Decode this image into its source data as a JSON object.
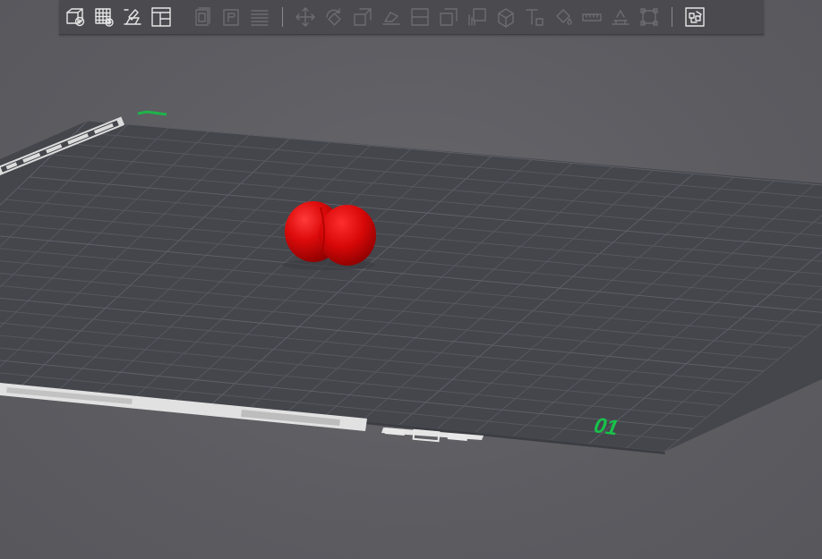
{
  "toolbar": {
    "groups": [
      [
        {
          "name": "add-object-icon",
          "enabled": true
        },
        {
          "name": "arrange-grid-icon",
          "enabled": true
        },
        {
          "name": "auto-orient-icon",
          "enabled": true
        },
        {
          "name": "layout-panel-icon",
          "enabled": true
        }
      ],
      [
        {
          "name": "copy-icon",
          "enabled": false
        },
        {
          "name": "paste-icon",
          "enabled": false
        },
        {
          "name": "slice-layers-icon",
          "enabled": false
        }
      ],
      [
        {
          "name": "move-icon",
          "enabled": false
        },
        {
          "name": "rotate-icon",
          "enabled": false
        },
        {
          "name": "scale-icon",
          "enabled": false
        },
        {
          "name": "lay-flat-icon",
          "enabled": false
        },
        {
          "name": "mirror-icon",
          "enabled": false
        },
        {
          "name": "cut-icon",
          "enabled": false
        },
        {
          "name": "support-icon",
          "enabled": false
        },
        {
          "name": "cube-icon",
          "enabled": false
        },
        {
          "name": "text-icon",
          "enabled": false
        },
        {
          "name": "paint-icon",
          "enabled": false
        },
        {
          "name": "measure-icon",
          "enabled": false
        },
        {
          "name": "height-range-icon",
          "enabled": false
        },
        {
          "name": "bounding-box-icon",
          "enabled": false
        }
      ],
      [
        {
          "name": "assembly-icon",
          "enabled": true
        }
      ]
    ]
  },
  "plate": {
    "number": "01",
    "corner_mark": "⌐"
  },
  "object": {
    "color": "#d90808"
  },
  "colors": {
    "background": "#5f5f64",
    "plate": "#45464c",
    "grid": "#575860",
    "plate_number": "#18c24a"
  }
}
